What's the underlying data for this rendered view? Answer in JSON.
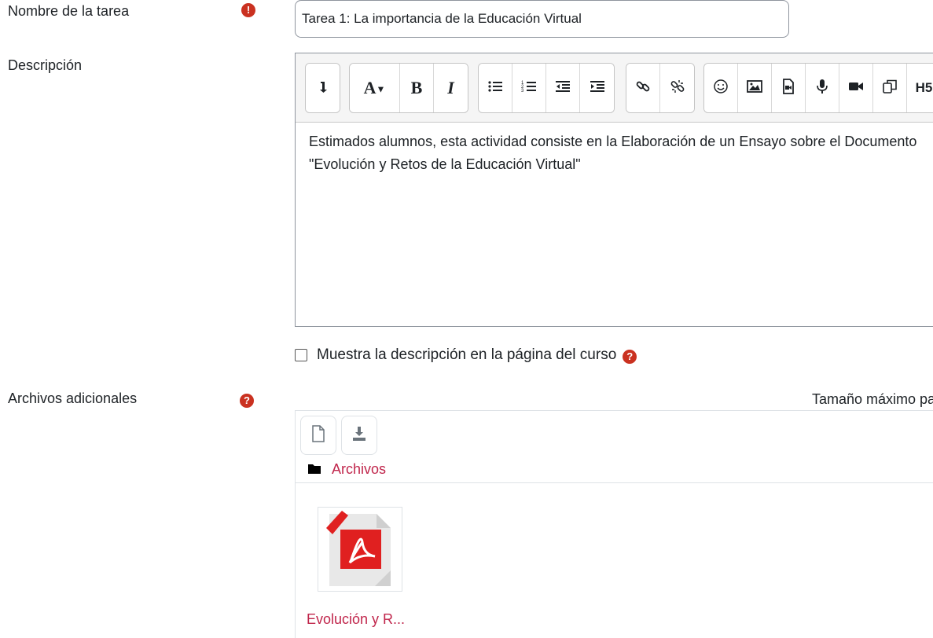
{
  "form": {
    "task_name_label": "Nombre de la tarea",
    "task_name_value": "Tarea 1: La importancia de la Educación Virtual",
    "required_icon": "!",
    "description_label": "Descripción",
    "description_text_line1": "Estimados alumnos, esta actividad consiste en la Elaboración de un Ensayo sobre el Documento",
    "description_text_line2": "\"Evolución y Retos de la Educación Virtual\"",
    "show_description_label": "Muestra la descripción en la página del curso",
    "help_icon": "?",
    "additional_files_label": "Archivos adicionales",
    "max_size_text": "Tamaño máximo pa"
  },
  "toolbar": {
    "groups": [
      {
        "buttons": [
          "show-more-icon"
        ]
      },
      {
        "buttons": [
          "font-style-icon",
          "bold-icon",
          "italic-icon"
        ]
      },
      {
        "buttons": [
          "unordered-list-icon",
          "ordered-list-icon",
          "outdent-icon",
          "indent-icon"
        ]
      },
      {
        "buttons": [
          "link-icon",
          "unlink-icon"
        ]
      },
      {
        "buttons": [
          "emoji-icon",
          "image-icon",
          "media-icon",
          "audio-record-icon",
          "video-record-icon",
          "copy-icon",
          "h5p-icon"
        ]
      }
    ],
    "font_style_label": "A",
    "bold_label": "B",
    "italic_label": "I",
    "h5p_label": "H5"
  },
  "filemanager": {
    "path_label": "Archivos",
    "file_name": "Evolución y R..."
  }
}
